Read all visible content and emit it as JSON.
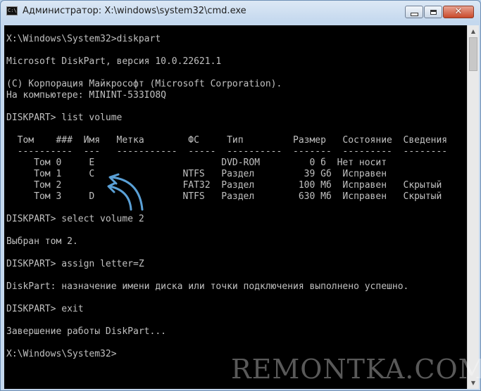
{
  "window": {
    "title": "Администратор: X:\\windows\\system32\\cmd.exe",
    "icon_text": "C:\\"
  },
  "console": {
    "lines": [
      "X:\\Windows\\System32>diskpart",
      "",
      "Microsoft DiskPart, версия 10.0.22621.1",
      "",
      "(C) Корпорация Майкрософт (Microsoft Corporation).",
      "На компьютере: MININT-533IO8Q",
      "",
      "DISKPART> list volume",
      "",
      "  Том    ###  Имя   Метка        ФС     Тип         Размер   Состояние  Сведения",
      "  ----------  ---   -----------  -----  ----------  -------  ---------  --------",
      "     Том 0     E                       DVD-ROM         0 б  Нет носит",
      "     Том 1     C                NTFS   Раздел         39 Gб  Исправен",
      "     Том 2                      FAT32  Раздел        100 Мб  Исправен   Скрытый",
      "     Том 3     D                NTFS   Раздел        630 Мб  Исправен   Скрытый",
      "",
      "DISKPART> select volume 2",
      "",
      "Выбран том 2.",
      "",
      "DISKPART> assign letter=Z",
      "",
      "DiskPart: назначение имени диска или точки подключения выполнено успешно.",
      "",
      "DISKPART> exit",
      "",
      "Завершение работы DiskPart...",
      "",
      "X:\\Windows\\System32>"
    ]
  },
  "arrow_color": "#5aa0d6",
  "watermark": "REMONTKA.COM"
}
